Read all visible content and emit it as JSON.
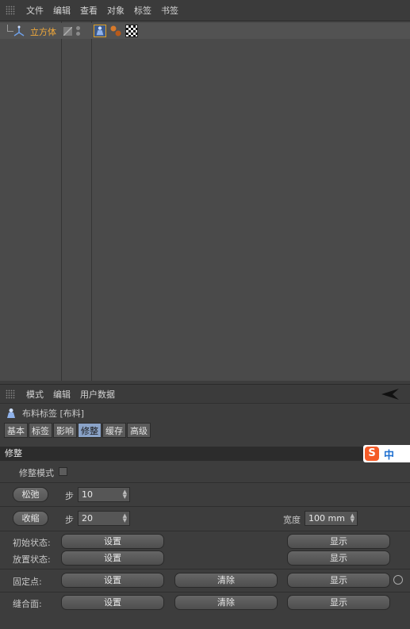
{
  "object_manager": {
    "menu": [
      "文件",
      "编辑",
      "查看",
      "对象",
      "标签",
      "书签"
    ],
    "object": {
      "name": "立方体"
    }
  },
  "attribute_manager": {
    "menu": [
      "模式",
      "编辑",
      "用户数据"
    ],
    "title": "布料标签 [布料]",
    "tabs": [
      {
        "label": "基本",
        "active": false
      },
      {
        "label": "标签",
        "active": false
      },
      {
        "label": "影响",
        "active": false
      },
      {
        "label": "修整",
        "active": true
      },
      {
        "label": "缓存",
        "active": false
      },
      {
        "label": "高级",
        "active": false
      }
    ],
    "section": "修整",
    "dress_mode_label": "修整模式",
    "relax": {
      "button": "松弛",
      "step_label": "步",
      "step_value": "10"
    },
    "shrink": {
      "button": "收缩",
      "step_label": "步",
      "step_value": "20",
      "width_label": "宽度",
      "width_value": "100 mm"
    },
    "init_state": {
      "label": "初始状态:",
      "set": "设置",
      "show": "显示"
    },
    "dress_state": {
      "label": "放置状态:",
      "set": "设置",
      "show": "显示"
    },
    "fix_points": {
      "label": "固定点:",
      "set": "设置",
      "clear": "清除",
      "show": "显示"
    },
    "seam_polys": {
      "label": "缝合面:",
      "set": "设置",
      "clear": "清除",
      "show": "显示"
    }
  },
  "ime": {
    "zh": "中"
  },
  "colors": {
    "object_name": "#f2a93a",
    "active_tab": "#8aa3c8",
    "ime_logo": "#f45b28"
  }
}
